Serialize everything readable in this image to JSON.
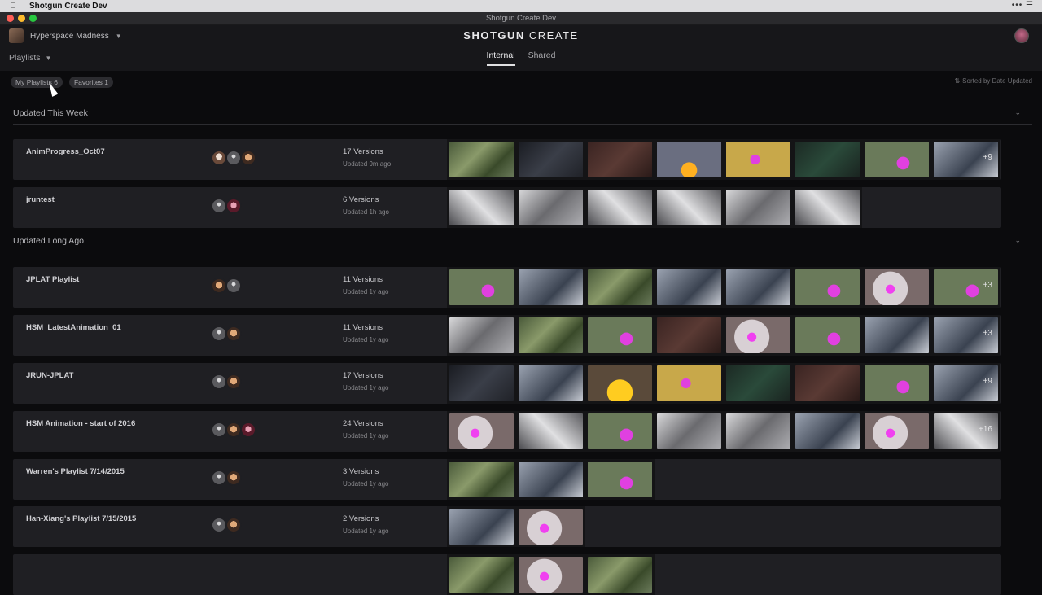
{
  "menubar": {
    "app_name": "Shotgun Create Dev",
    "right_icons": "••• ☰"
  },
  "window": {
    "title": "Shotgun Create Dev"
  },
  "header": {
    "project": "Hyperspace Madness",
    "logo_bold": "SHOTGUN",
    "logo_rest": " CREATE",
    "playlists_menu": "Playlists",
    "tabs": [
      {
        "label": "Internal",
        "active": true
      },
      {
        "label": "Shared",
        "active": false
      }
    ]
  },
  "filters": {
    "my_playlists": "My Playlists 6",
    "favorites": "Favorites 1",
    "sorted": "Sorted by Date Updated"
  },
  "sections": [
    {
      "title": "Updated This Week"
    },
    {
      "title": "Updated Long Ago"
    }
  ],
  "playlists": [
    {
      "name": "AnimProgress_Oct07",
      "versions": "17 Versions",
      "updated": "Updated 9m ago",
      "people": [
        "man",
        "gray",
        "tan"
      ],
      "thumbs": [
        "t-green",
        "t-dark",
        "t-red",
        "t-orange",
        "t-yellow",
        "t-teal",
        "t-magenta",
        "t-char"
      ],
      "more": "+9"
    },
    {
      "name": "jruntest",
      "versions": "6 Versions",
      "updated": "Updated 1h ago",
      "people": [
        "gray",
        "pink"
      ],
      "thumbs": [
        "t-gray2",
        "t-gray",
        "t-gray2",
        "t-gray2",
        "t-gray",
        "t-gray2"
      ],
      "more": ""
    },
    {
      "name": "JPLAT Playlist",
      "versions": "11 Versions",
      "updated": "Updated 1y ago",
      "people": [
        "tan",
        "gray"
      ],
      "thumbs": [
        "t-magenta",
        "t-char",
        "t-green",
        "t-char",
        "t-char",
        "t-magenta",
        "t-pinkflower",
        "t-magenta"
      ],
      "more": "+3"
    },
    {
      "name": "HSM_LatestAnimation_01",
      "versions": "11 Versions",
      "updated": "Updated 1y ago",
      "people": [
        "gray",
        "tan"
      ],
      "thumbs": [
        "t-gray",
        "t-green",
        "t-magenta",
        "t-red",
        "t-pinkflower",
        "t-magenta",
        "t-char",
        "t-char"
      ],
      "more": "+3"
    },
    {
      "name": "JRUN-JPLAT",
      "versions": "17 Versions",
      "updated": "Updated 1y ago",
      "people": [
        "gray",
        "tan"
      ],
      "thumbs": [
        "t-dark",
        "t-char",
        "t-sun",
        "t-yellow",
        "t-teal",
        "t-red",
        "t-magenta",
        "t-char"
      ],
      "more": "+9"
    },
    {
      "name": "HSM Animation - start of 2016",
      "versions": "24 Versions",
      "updated": "Updated 1y ago",
      "people": [
        "gray",
        "tan",
        "pink"
      ],
      "thumbs": [
        "t-pinkflower",
        "t-gray2",
        "t-magenta",
        "t-gray",
        "t-gray",
        "t-char",
        "t-pinkflower",
        "t-gray2"
      ],
      "more": "+16"
    },
    {
      "name": "Warren's Playlist 7/14/2015",
      "versions": "3 Versions",
      "updated": "Updated 1y ago",
      "people": [
        "gray",
        "tan"
      ],
      "thumbs": [
        "t-green",
        "t-char",
        "t-magenta"
      ],
      "more": ""
    },
    {
      "name": "Han-Xiang's Playlist 7/15/2015",
      "versions": "2 Versions",
      "updated": "Updated 1y ago",
      "people": [
        "gray",
        "tan"
      ],
      "thumbs": [
        "t-char",
        "t-pinkflower"
      ],
      "more": ""
    },
    {
      "name": "",
      "versions": "",
      "updated": "",
      "people": [],
      "thumbs": [
        "t-green",
        "t-pinkflower",
        "t-green"
      ],
      "more": ""
    }
  ]
}
